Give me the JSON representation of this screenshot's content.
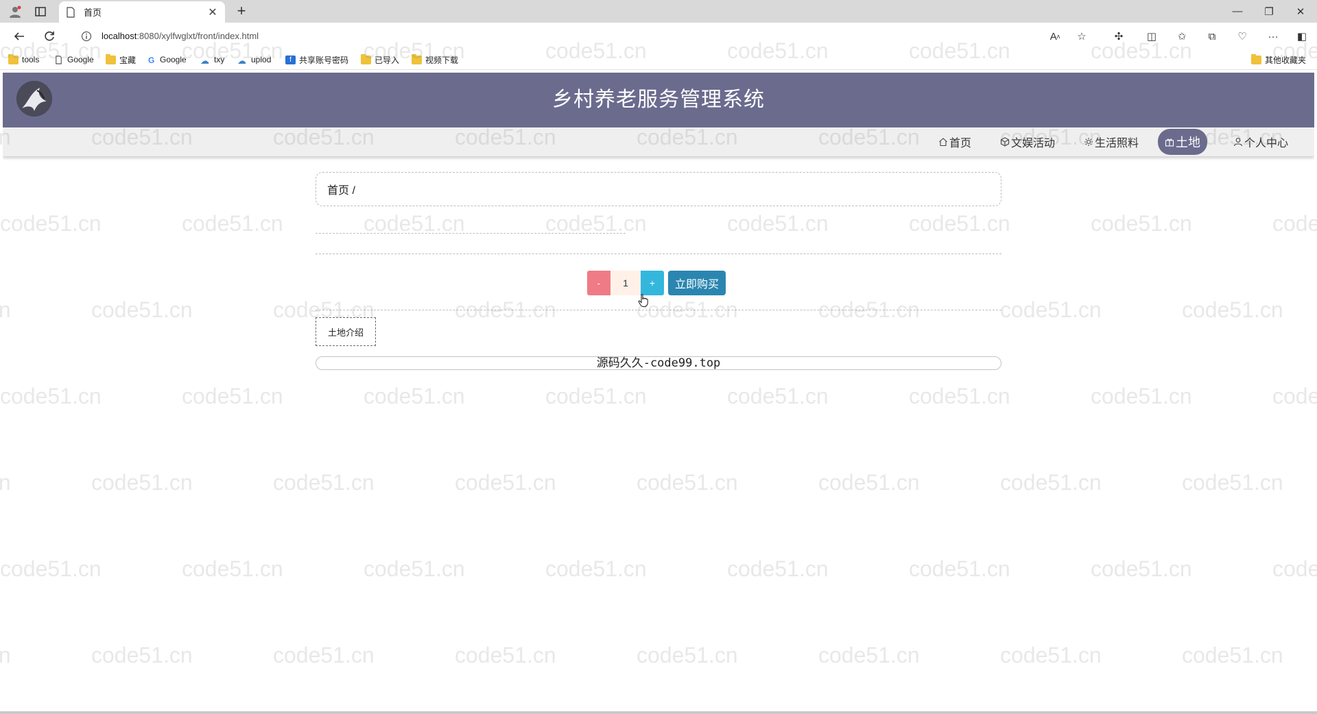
{
  "browser": {
    "tab_title": "首页",
    "url_host": "localhost",
    "url_rest": ":8080/xylfwglxt/front/index.html",
    "bookmarks": [
      "tools",
      "Google",
      "宝藏",
      "Google",
      "txy",
      "uplod",
      "共享账号密码",
      "已导入",
      "视频下载"
    ],
    "other_bookmarks": "其他收藏夹"
  },
  "site": {
    "title": "乡村养老服务管理系统",
    "nav": {
      "home": "首页",
      "activities": "文娱活动",
      "care": "生活照料",
      "land": "土地",
      "profile": "个人中心"
    }
  },
  "main": {
    "breadcrumb": "首页 /",
    "quantity": {
      "minus_label": "-",
      "value": "1",
      "plus_label": "+"
    },
    "buy_label": "立即购买",
    "intro_tab": "土地介绍",
    "footer": "源码久久-code99.top"
  },
  "watermark": "code51.cn",
  "colors": {
    "header": "#6b6b8e",
    "minus": "#ef7b86",
    "plus": "#33b7dd",
    "buy": "#2a86b0"
  }
}
